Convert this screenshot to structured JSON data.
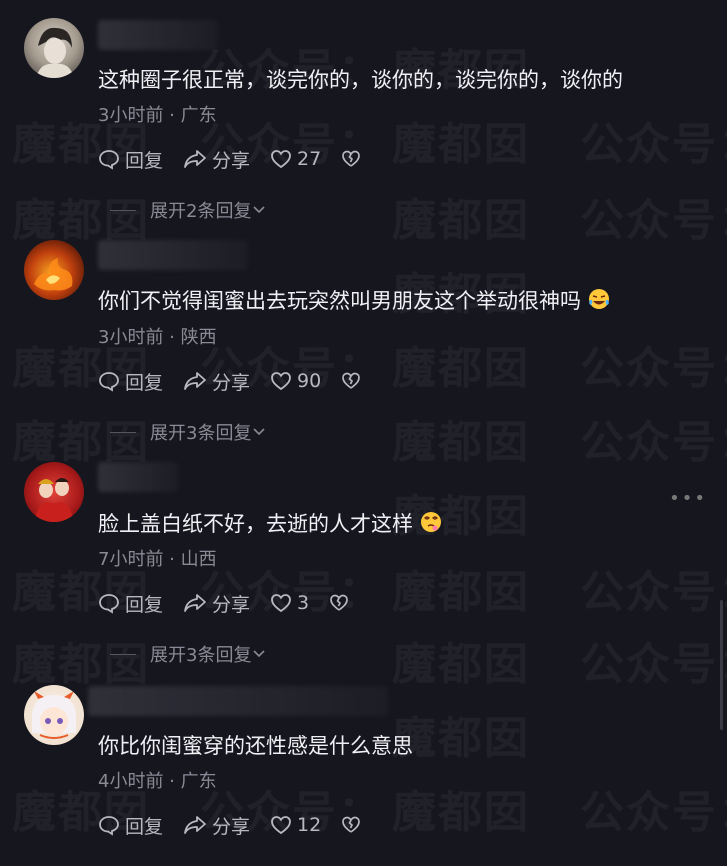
{
  "watermark": {
    "text_a": "魔都囡",
    "text_b": "公众号："
  },
  "comments": [
    {
      "text": "这种圈子很正常，谈完你的，谈你的，谈完你的，谈你的",
      "meta": "3小时前 · 广东",
      "reply_label": "回复",
      "share_label": "分享",
      "likes": "27",
      "expand": "展开2条回复",
      "emoji": ""
    },
    {
      "text": "你们不觉得闺蜜出去玩突然叫男朋友这个举动很神吗",
      "meta": "3小时前 · 陕西",
      "reply_label": "回复",
      "share_label": "分享",
      "likes": "90",
      "expand": "展开3条回复",
      "emoji": "laughing-tears-emoji"
    },
    {
      "text": "脸上盖白纸不好，去逝的人才这样",
      "meta": "7小时前 · 山西",
      "reply_label": "回复",
      "share_label": "分享",
      "likes": "3",
      "expand": "展开3条回复",
      "emoji": "dizzy-face-emoji"
    },
    {
      "text": "你比你闺蜜穿的还性感是什么意思",
      "meta": "4小时前 · 广东",
      "reply_label": "回复",
      "share_label": "分享",
      "likes": "12",
      "expand": "",
      "emoji": ""
    }
  ],
  "colors": {
    "background": "#16161e",
    "text": "#f0f0f4",
    "meta": "#8a8a96"
  }
}
